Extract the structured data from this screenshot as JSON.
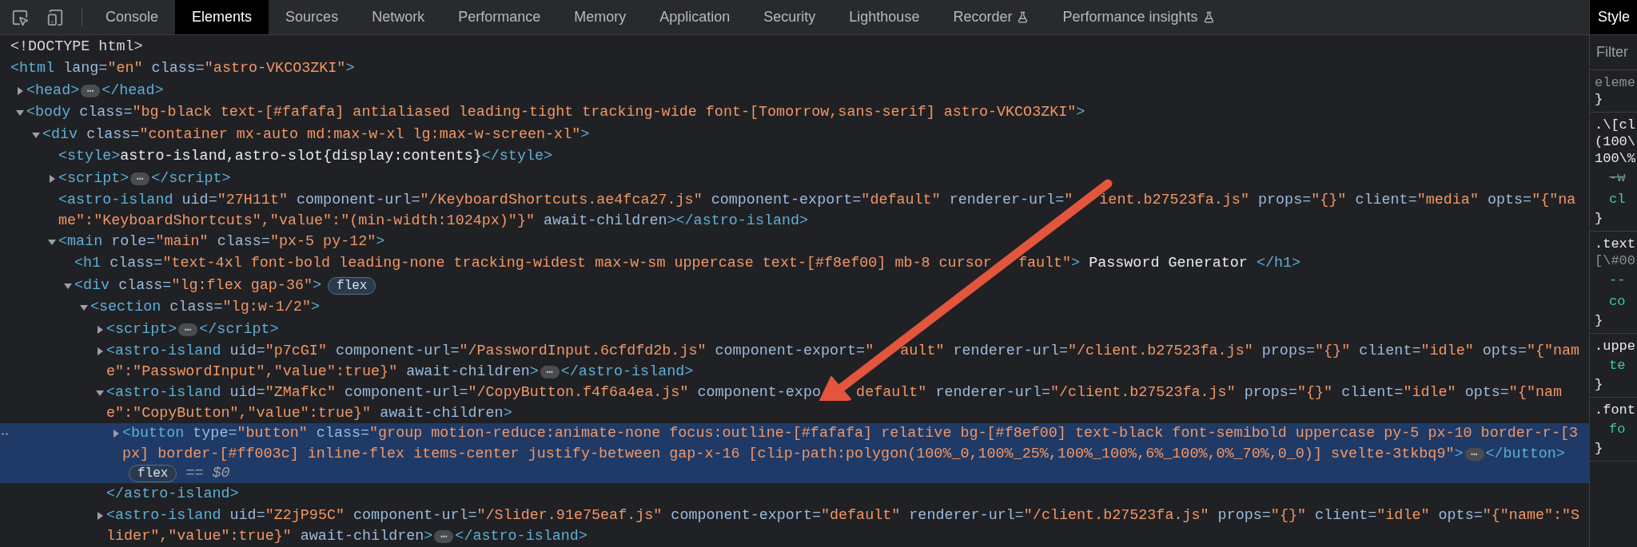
{
  "toolbar": {
    "tabs": [
      {
        "label": "Console",
        "selected": false,
        "kind": "plain"
      },
      {
        "label": "Elements",
        "selected": true,
        "kind": "plain"
      },
      {
        "label": "Sources",
        "selected": false,
        "kind": "plain"
      },
      {
        "label": "Network",
        "selected": false,
        "kind": "plain"
      },
      {
        "label": "Performance",
        "selected": false,
        "kind": "plain"
      },
      {
        "label": "Memory",
        "selected": false,
        "kind": "plain"
      },
      {
        "label": "Application",
        "selected": false,
        "kind": "plain"
      },
      {
        "label": "Security",
        "selected": false,
        "kind": "plain"
      },
      {
        "label": "Lighthouse",
        "selected": false,
        "kind": "plain"
      },
      {
        "label": "Recorder",
        "selected": false,
        "kind": "experimental"
      },
      {
        "label": "Performance insights",
        "selected": false,
        "kind": "experimental"
      }
    ]
  },
  "tree": [
    {
      "selected": false,
      "lines": [
        [
          {
            "kind": "doctype",
            "text": "<!DOCTYPE html>"
          }
        ]
      ]
    },
    {
      "selected": false,
      "lines": [
        [
          {
            "kind": "tag",
            "text": "<html"
          },
          {
            "kind": "attr",
            "text": " lang="
          },
          {
            "kind": "value",
            "text": "\"en\""
          },
          {
            "kind": "attr",
            "text": " class="
          },
          {
            "kind": "value",
            "text": "\"astro-VKCO3ZKI\""
          },
          {
            "kind": "tag",
            "text": ">"
          }
        ]
      ],
      "children": [
        {
          "selected": false,
          "expanded": false,
          "lines": [
            [
              {
                "kind": "tag",
                "text": "<head>"
              },
              {
                "kind": "ellipsis",
                "text": "⋯"
              },
              {
                "kind": "tag",
                "text": "</head>"
              }
            ]
          ]
        },
        {
          "selected": false,
          "expanded": true,
          "lines": [
            [
              {
                "kind": "tag",
                "text": "<body"
              },
              {
                "kind": "attr",
                "text": " class="
              },
              {
                "kind": "value",
                "text": "\"bg-black text-[#fafafa] antialiased leading-tight tracking-wide font-[Tomorrow,sans-serif] astro-VKCO3ZKI\""
              },
              {
                "kind": "tag",
                "text": ">"
              }
            ]
          ],
          "children": [
            {
              "selected": false,
              "expanded": true,
              "lines": [
                [
                  {
                    "kind": "tag",
                    "text": "<div"
                  },
                  {
                    "kind": "attr",
                    "text": " class="
                  },
                  {
                    "kind": "value",
                    "text": "\"container mx-auto md:max-w-xl lg:max-w-screen-xl\""
                  },
                  {
                    "kind": "tag",
                    "text": ">"
                  }
                ]
              ],
              "children": [
                {
                  "selected": false,
                  "lines": [
                    [
                      {
                        "kind": "tag",
                        "text": "<style>"
                      },
                      {
                        "kind": "text",
                        "text": "astro-island,astro-slot{display:contents}"
                      },
                      {
                        "kind": "tag",
                        "text": "</style>"
                      }
                    ]
                  ]
                },
                {
                  "selected": false,
                  "expanded": false,
                  "lines": [
                    [
                      {
                        "kind": "tag",
                        "text": "<script>"
                      },
                      {
                        "kind": "ellipsis",
                        "text": "⋯"
                      },
                      {
                        "kind": "tag",
                        "text": "</script>"
                      }
                    ]
                  ]
                },
                {
                  "selected": false,
                  "lines": [
                    [
                      {
                        "kind": "tag",
                        "text": "<astro-island"
                      },
                      {
                        "kind": "attr",
                        "text": " uid="
                      },
                      {
                        "kind": "value",
                        "text": "\"27H11t\""
                      },
                      {
                        "kind": "attr",
                        "text": " component-url="
                      },
                      {
                        "kind": "value",
                        "text": "\"/KeyboardShortcuts.ae4fca27.js\""
                      },
                      {
                        "kind": "attr",
                        "text": " component-export="
                      },
                      {
                        "kind": "value",
                        "text": "\"default\""
                      },
                      {
                        "kind": "attr",
                        "text": " renderer-url="
                      },
                      {
                        "kind": "value",
                        "text": "\""
                      },
                      {
                        "kind": "gap"
                      },
                      {
                        "kind": "value",
                        "text": "ient.b27523fa.js\""
                      },
                      {
                        "kind": "attr",
                        "text": " props="
                      },
                      {
                        "kind": "value",
                        "text": "\"{}\""
                      },
                      {
                        "kind": "attr",
                        "text": " client="
                      },
                      {
                        "kind": "value",
                        "text": "\"media\""
                      },
                      {
                        "kind": "attr",
                        "text": " opts="
                      },
                      {
                        "kind": "value",
                        "text": "\"{\"na"
                      }
                    ],
                    [
                      {
                        "kind": "value",
                        "text": "me\":\"KeyboardShortcuts\",\"value\":\"(min-width:1024px)\"}\""
                      },
                      {
                        "kind": "attr",
                        "text": " await-children"
                      },
                      {
                        "kind": "tag",
                        "text": "></astro-island>"
                      }
                    ]
                  ]
                },
                {
                  "selected": false,
                  "expanded": true,
                  "lines": [
                    [
                      {
                        "kind": "tag",
                        "text": "<main"
                      },
                      {
                        "kind": "attr",
                        "text": " role="
                      },
                      {
                        "kind": "value",
                        "text": "\"main\""
                      },
                      {
                        "kind": "attr",
                        "text": " class="
                      },
                      {
                        "kind": "value",
                        "text": "\"px-5 py-12\""
                      },
                      {
                        "kind": "tag",
                        "text": ">"
                      }
                    ]
                  ],
                  "children": [
                    {
                      "selected": false,
                      "lines": [
                        [
                          {
                            "kind": "tag",
                            "text": "<h1"
                          },
                          {
                            "kind": "attr",
                            "text": " class="
                          },
                          {
                            "kind": "value",
                            "text": "\"text-4xl font-bold leading-none tracking-widest max-w-sm uppercase text-[#f8ef00] mb-8 cursor"
                          },
                          {
                            "kind": "gap"
                          },
                          {
                            "kind": "value",
                            "text": "fault\""
                          },
                          {
                            "kind": "tag",
                            "text": ">"
                          },
                          {
                            "kind": "text",
                            "text": " Password Generator "
                          },
                          {
                            "kind": "tag",
                            "text": "</h1>"
                          }
                        ]
                      ]
                    },
                    {
                      "selected": false,
                      "expanded": true,
                      "lines": [
                        [
                          {
                            "kind": "tag",
                            "text": "<div"
                          },
                          {
                            "kind": "attr",
                            "text": " class="
                          },
                          {
                            "kind": "value",
                            "text": "\"lg:flex gap-36\""
                          },
                          {
                            "kind": "tag",
                            "text": ">"
                          },
                          {
                            "kind": "badge",
                            "text": "flex"
                          }
                        ]
                      ],
                      "children": [
                        {
                          "selected": false,
                          "expanded": true,
                          "lines": [
                            [
                              {
                                "kind": "tag",
                                "text": "<section"
                              },
                              {
                                "kind": "attr",
                                "text": " class="
                              },
                              {
                                "kind": "value",
                                "text": "\"lg:w-1/2\""
                              },
                              {
                                "kind": "tag",
                                "text": ">"
                              }
                            ]
                          ],
                          "children": [
                            {
                              "selected": false,
                              "expanded": false,
                              "lines": [
                                [
                                  {
                                    "kind": "tag",
                                    "text": "<script>"
                                  },
                                  {
                                    "kind": "ellipsis",
                                    "text": "⋯"
                                  },
                                  {
                                    "kind": "tag",
                                    "text": "</script>"
                                  }
                                ]
                              ]
                            },
                            {
                              "selected": false,
                              "expanded": false,
                              "lines": [
                                [
                                  {
                                    "kind": "tag",
                                    "text": "<astro-island"
                                  },
                                  {
                                    "kind": "attr",
                                    "text": " uid="
                                  },
                                  {
                                    "kind": "value",
                                    "text": "\"p7cGI\""
                                  },
                                  {
                                    "kind": "attr",
                                    "text": " component-url="
                                  },
                                  {
                                    "kind": "value",
                                    "text": "\"/PasswordInput.6cfdfd2b.js\""
                                  },
                                  {
                                    "kind": "attr",
                                    "text": " component-export="
                                  },
                                  {
                                    "kind": "value",
                                    "text": "\""
                                  },
                                  {
                                    "kind": "gap"
                                  },
                                  {
                                    "kind": "value",
                                    "text": "ault\""
                                  },
                                  {
                                    "kind": "attr",
                                    "text": " renderer-url="
                                  },
                                  {
                                    "kind": "value",
                                    "text": "\"/client.b27523fa.js\""
                                  },
                                  {
                                    "kind": "attr",
                                    "text": " props="
                                  },
                                  {
                                    "kind": "value",
                                    "text": "\"{}\""
                                  },
                                  {
                                    "kind": "attr",
                                    "text": " client="
                                  },
                                  {
                                    "kind": "value",
                                    "text": "\"idle\""
                                  },
                                  {
                                    "kind": "attr",
                                    "text": " opts="
                                  },
                                  {
                                    "kind": "value",
                                    "text": "\"{\"nam"
                                  }
                                ],
                                [
                                  {
                                    "kind": "value",
                                    "text": "e\":\"PasswordInput\",\"value\":true}\""
                                  },
                                  {
                                    "kind": "attr",
                                    "text": " await-children"
                                  },
                                  {
                                    "kind": "tag",
                                    "text": ">"
                                  },
                                  {
                                    "kind": "ellipsis",
                                    "text": "⋯"
                                  },
                                  {
                                    "kind": "tag",
                                    "text": "</astro-island>"
                                  }
                                ]
                              ]
                            },
                            {
                              "selected": false,
                              "expanded": true,
                              "lines": [
                                [
                                  {
                                    "kind": "tag",
                                    "text": "<astro-island"
                                  },
                                  {
                                    "kind": "attr",
                                    "text": " uid="
                                  },
                                  {
                                    "kind": "value",
                                    "text": "\"ZMafkc\""
                                  },
                                  {
                                    "kind": "attr",
                                    "text": " component-url="
                                  },
                                  {
                                    "kind": "value",
                                    "text": "\"/CopyButton.f4f6a4ea.js\""
                                  },
                                  {
                                    "kind": "attr",
                                    "text": " component-expo"
                                  },
                                  {
                                    "kind": "widegap"
                                  },
                                  {
                                    "kind": "value",
                                    "text": "default\""
                                  },
                                  {
                                    "kind": "attr",
                                    "text": " renderer-url="
                                  },
                                  {
                                    "kind": "value",
                                    "text": "\"/client.b27523fa.js\""
                                  },
                                  {
                                    "kind": "attr",
                                    "text": " props="
                                  },
                                  {
                                    "kind": "value",
                                    "text": "\"{}\""
                                  },
                                  {
                                    "kind": "attr",
                                    "text": " client="
                                  },
                                  {
                                    "kind": "value",
                                    "text": "\"idle\""
                                  },
                                  {
                                    "kind": "attr",
                                    "text": " opts="
                                  },
                                  {
                                    "kind": "value",
                                    "text": "\"{\"nam"
                                  }
                                ],
                                [
                                  {
                                    "kind": "value",
                                    "text": "e\":\"CopyButton\",\"value\":true}\""
                                  },
                                  {
                                    "kind": "attr",
                                    "text": " await-children"
                                  },
                                  {
                                    "kind": "tag",
                                    "text": ">"
                                  }
                                ]
                              ],
                              "children": [
                                {
                                  "selected": true,
                                  "expanded": false,
                                  "lines": [
                                    [
                                      {
                                        "kind": "tag",
                                        "text": "<button"
                                      },
                                      {
                                        "kind": "attr",
                                        "text": " type="
                                      },
                                      {
                                        "kind": "value",
                                        "text": "\"button\""
                                      },
                                      {
                                        "kind": "attr",
                                        "text": " class="
                                      },
                                      {
                                        "kind": "value",
                                        "text": "\"group motion-reduce:animate-none focus:outline-[#fafafa] relative bg-[#f8ef00] text-black font-semibold uppercase py-5 px-10 border-r-[3"
                                      }
                                    ],
                                    [
                                      {
                                        "kind": "value",
                                        "text": "px] border-[#ff003c] inline-flex items-center justify-between gap-x-16 [clip-path:polygon(100%_0,100%_25%,100%_100%,6%_100%,0%_70%,0_0)] svelte-3tkbq9\""
                                      },
                                      {
                                        "kind": "tag",
                                        "text": ">"
                                      },
                                      {
                                        "kind": "ellipsis",
                                        "text": "⋯"
                                      },
                                      {
                                        "kind": "tag",
                                        "text": "</button>"
                                      }
                                    ],
                                    [
                                      {
                                        "kind": "badge",
                                        "text": "flex"
                                      },
                                      {
                                        "kind": "ref",
                                        "text": " == $0"
                                      }
                                    ]
                                  ]
                                }
                              ],
                              "closing": [
                                {
                                  "kind": "tag",
                                  "text": "</astro-island>"
                                }
                              ]
                            },
                            {
                              "selected": false,
                              "expanded": false,
                              "lines": [
                                [
                                  {
                                    "kind": "tag",
                                    "text": "<astro-island"
                                  },
                                  {
                                    "kind": "attr",
                                    "text": " uid="
                                  },
                                  {
                                    "kind": "value",
                                    "text": "\"Z2jP95C\""
                                  },
                                  {
                                    "kind": "attr",
                                    "text": " component-url="
                                  },
                                  {
                                    "kind": "value",
                                    "text": "\"/Slider.91e75eaf.js\""
                                  },
                                  {
                                    "kind": "attr",
                                    "text": " component-export="
                                  },
                                  {
                                    "kind": "value",
                                    "text": "\"default\""
                                  },
                                  {
                                    "kind": "attr",
                                    "text": " renderer-url="
                                  },
                                  {
                                    "kind": "value",
                                    "text": "\"/client.b27523fa.js\""
                                  },
                                  {
                                    "kind": "attr",
                                    "text": " props="
                                  },
                                  {
                                    "kind": "value",
                                    "text": "\"{}\""
                                  },
                                  {
                                    "kind": "attr",
                                    "text": " client="
                                  },
                                  {
                                    "kind": "value",
                                    "text": "\"idle\""
                                  },
                                  {
                                    "kind": "attr",
                                    "text": " opts="
                                  },
                                  {
                                    "kind": "value",
                                    "text": "\"{\"name\":\"S"
                                  }
                                ],
                                [
                                  {
                                    "kind": "value",
                                    "text": "lider\",\"value\":true}\""
                                  },
                                  {
                                    "kind": "attr",
                                    "text": " await-children"
                                  },
                                  {
                                    "kind": "tag",
                                    "text": ">"
                                  },
                                  {
                                    "kind": "ellipsis",
                                    "text": "⋯"
                                  },
                                  {
                                    "kind": "tag",
                                    "text": "</astro-island>"
                                  }
                                ]
                              ]
                            }
                          ]
                        }
                      ]
                    }
                  ]
                }
              ]
            }
          ]
        }
      ]
    }
  ],
  "styles_panel": {
    "tabs": [
      {
        "label": "Style",
        "selected": true
      }
    ],
    "filter": {
      "placeholder": "Filter"
    },
    "rules": [
      {
        "selector_lines": [
          {
            "text": "eleme",
            "dimmed": true
          }
        ],
        "closing": "}"
      },
      {
        "selector_lines": [
          {
            "text": ".\\[cl",
            "dimmed": false
          },
          {
            "text": "(100\\",
            "dimmed": false
          },
          {
            "text": "100\\%",
            "dimmed": false
          }
        ],
        "declarations": [
          {
            "name": "-w",
            "disabled": true
          },
          {
            "name": "cl",
            "disabled": false
          }
        ],
        "closing": "}"
      },
      {
        "selector_lines": [
          {
            "text": ".text",
            "dimmed": false
          },
          {
            "text": "[\\#00",
            "dimmed": true
          }
        ],
        "declarations": [
          {
            "name": "--",
            "disabled": false
          },
          {
            "name": "co",
            "disabled": false
          }
        ],
        "closing": "}"
      },
      {
        "selector_lines": [
          {
            "text": ".uppe",
            "dimmed": false
          }
        ],
        "declarations": [
          {
            "name": "te",
            "disabled": false
          }
        ],
        "closing": "}"
      },
      {
        "selector_lines": [
          {
            "text": ".font",
            "dimmed": false
          }
        ],
        "declarations": [
          {
            "name": "fo",
            "disabled": false
          }
        ],
        "closing": "}"
      }
    ]
  }
}
